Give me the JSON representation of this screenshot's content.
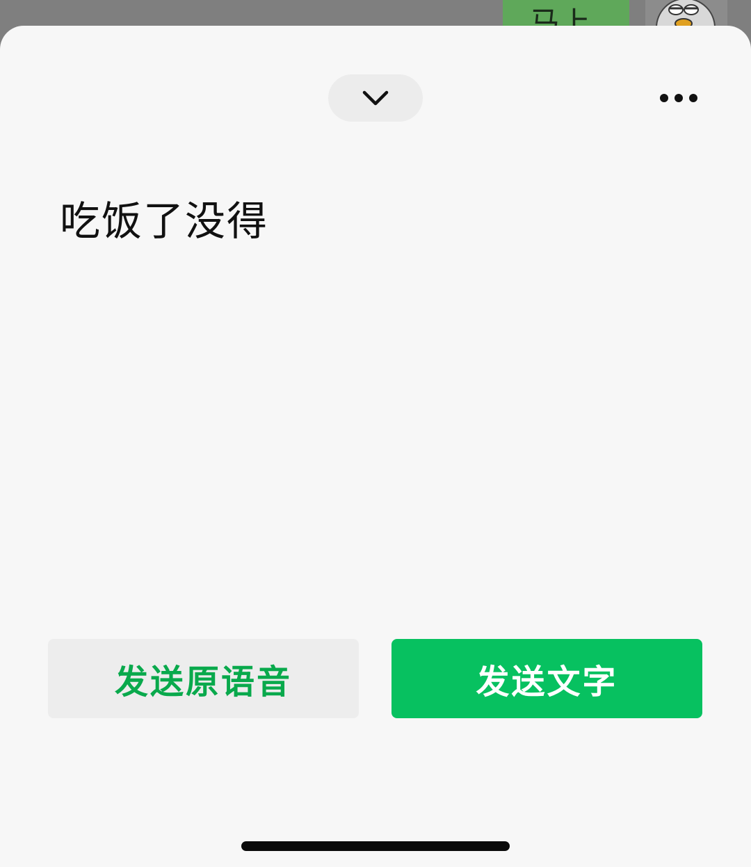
{
  "background": {
    "chat_bubble_text": "马上"
  },
  "sheet": {
    "collapse_icon": "chevron-down-icon",
    "more_icon": "more-horizontal-icon",
    "transcript": "吃饭了没得",
    "send_voice_label": "发送原语音",
    "send_text_label": "发送文字"
  },
  "colors": {
    "accent_green": "#07c160",
    "voice_label_green": "#09a94c",
    "sheet_background": "#f7f7f7"
  }
}
